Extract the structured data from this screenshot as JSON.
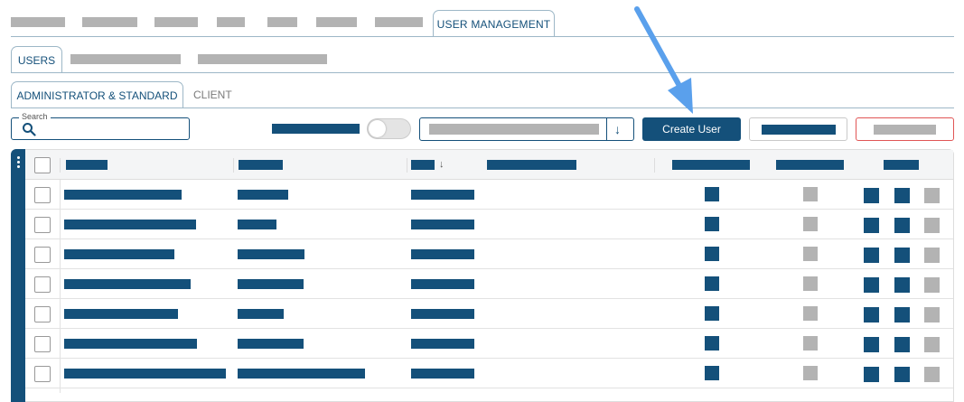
{
  "top_tabs": {
    "active_label": "USER MANAGEMENT"
  },
  "sub_tabs": {
    "active_label": "USERS"
  },
  "user_tabs": {
    "active_label": "ADMINISTRATOR & STANDARD",
    "other_label": "CLIENT"
  },
  "toolbar": {
    "search_label": "Search",
    "search_value": "",
    "toggle_on": false,
    "create_user_label": "Create User"
  },
  "table": {
    "row_count": 7
  },
  "colors": {
    "primary": "#14507a",
    "redacted": "#b3b3b3",
    "danger_border": "#e05555",
    "annotation_arrow": "#5aa0ec"
  }
}
